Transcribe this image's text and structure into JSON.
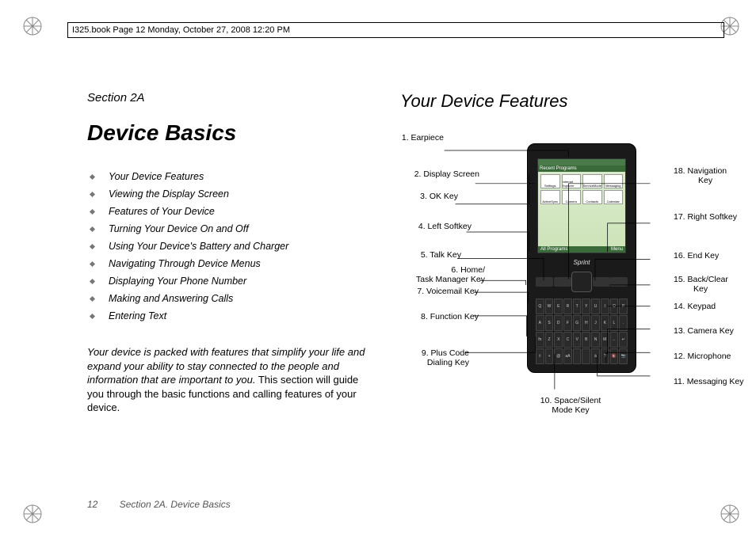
{
  "header": {
    "runningHead": "I325.book  Page 12  Monday, October 27, 2008  12:20 PM"
  },
  "left": {
    "sectionLabel": "Section 2A",
    "title": "Device Basics",
    "toc": [
      "Your Device Features",
      "Viewing the Display Screen",
      "Features of Your Device",
      "Turning Your Device On and Off",
      "Using Your Device's Battery and Charger",
      "Navigating Through Device Menus",
      "Displaying Your Phone Number",
      "Making and Answering Calls",
      "Entering Text"
    ],
    "intro": {
      "lead": "Your device is packed with features that simplify your life and expand your ability to stay connected to the people and information that are important to you.",
      "rest": " This section will guide you through the basic functions and calling features of your device."
    }
  },
  "right": {
    "title": "Your Device Features",
    "phone": {
      "brand": "Sprint",
      "screen": {
        "titleBar": "Recent Programs",
        "softLeft": "All Programs",
        "softRight": "Menu",
        "apps": [
          "Settings",
          "Internet Explorer",
          "ServiceMode",
          "Messaging",
          "ActiveSync",
          "Camera",
          "Contacts",
          "Calendar"
        ]
      },
      "keys": [
        "Q",
        "W",
        "E",
        "R",
        "T",
        "Y",
        "U",
        "I",
        "O",
        "P",
        "A",
        "S",
        "D",
        "F",
        "G",
        "H",
        "J",
        "K",
        "L",
        ".",
        "fn",
        "Z",
        "X",
        "C",
        "V",
        "B",
        "N",
        "M",
        "←",
        "↵",
        "⇧",
        "+",
        "@",
        "aA",
        " ",
        " ",
        "ä",
        "?",
        "🔇",
        "📷"
      ]
    },
    "callouts": {
      "c1": "1. Earpiece",
      "c2": "2. Display Screen",
      "c3": "3. OK Key",
      "c4": "4. Left Softkey",
      "c5": "5. Talk Key",
      "c6a": "6. Home/",
      "c6b": "Task Manager Key",
      "c7": "7. Voicemail Key",
      "c8": "8. Function Key",
      "c9a": "9. Plus Code",
      "c9b": "Dialing Key",
      "c10a": "10. Space/Silent",
      "c10b": "Mode Key",
      "c11": "11. Messaging Key",
      "c12": "12. Microphone",
      "c13": "13. Camera Key",
      "c14": "14. Keypad",
      "c15a": "15. Back/Clear",
      "c15b": "Key",
      "c16": "16. End Key",
      "c17": "17. Right Softkey",
      "c18a": "18. Navigation",
      "c18b": "Key"
    }
  },
  "footer": {
    "pageNumber": "12",
    "sectionRef": "Section 2A. Device Basics"
  }
}
